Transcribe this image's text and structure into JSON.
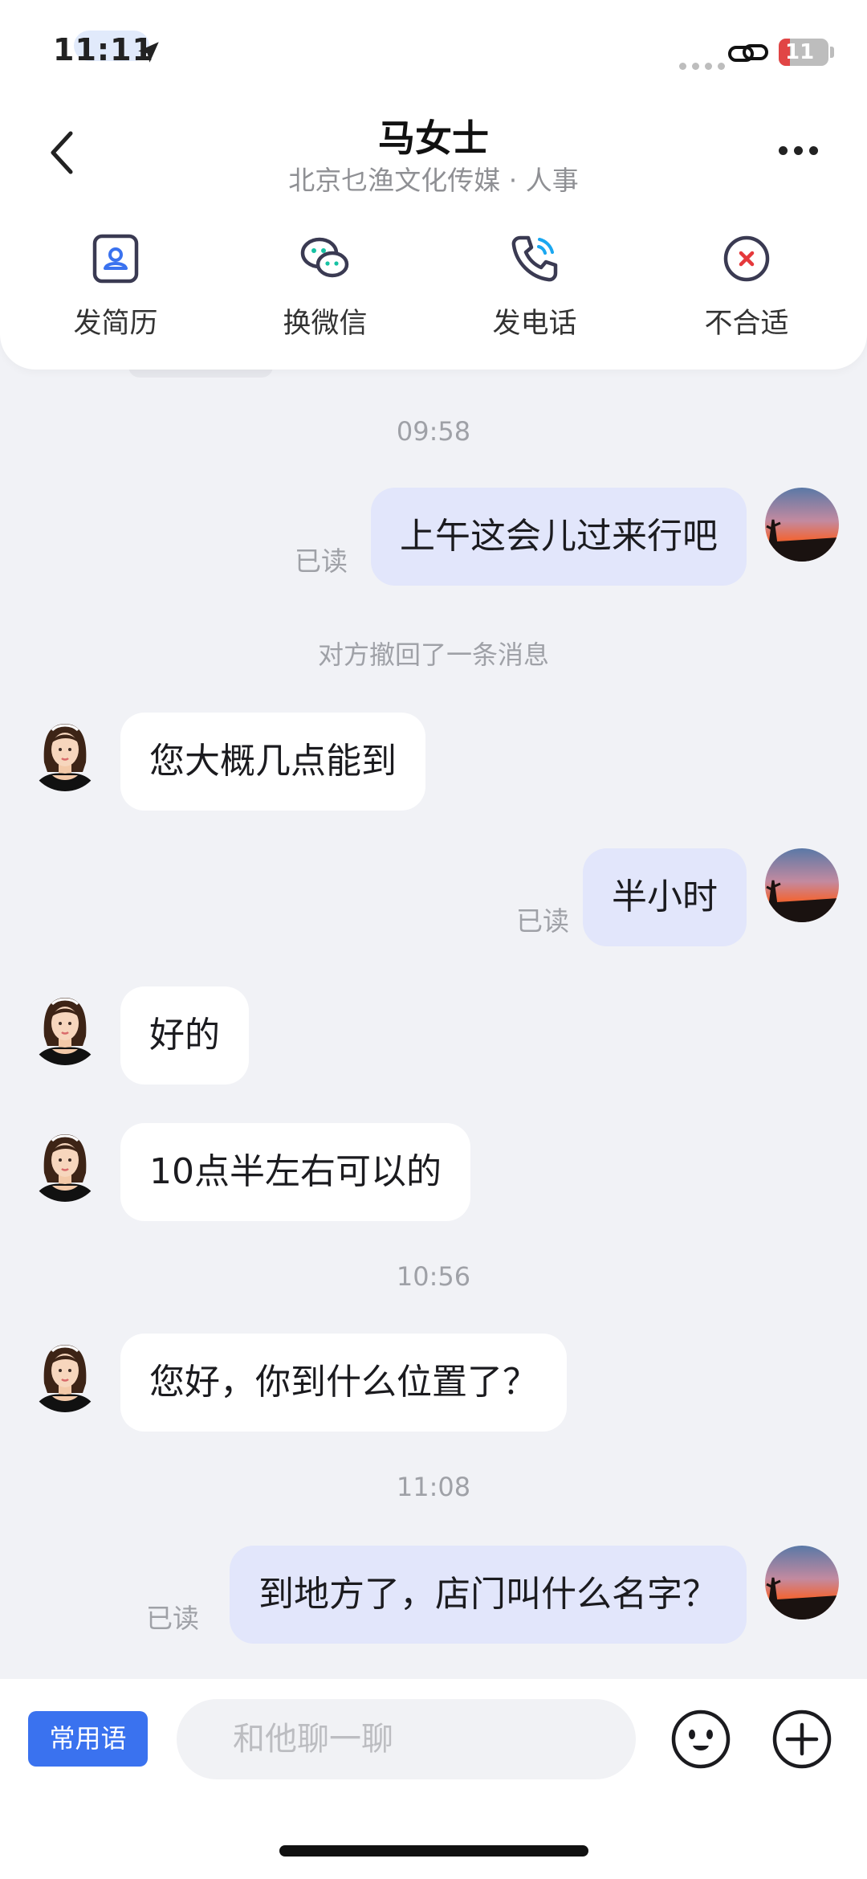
{
  "status_bar": {
    "time": "11:11",
    "battery": "11",
    "battery_level": 0.11,
    "icons": [
      "location-arrow-icon",
      "signal-dots-icon",
      "link-icon",
      "battery-icon"
    ]
  },
  "header": {
    "title": "马女士",
    "subtitle": "北京乜渔文化传媒 · 人事",
    "back_icon": "chevron-left-icon",
    "more_icon": "more-dots-icon"
  },
  "actions": [
    {
      "label": "发简历",
      "icon": "resume-icon"
    },
    {
      "label": "换微信",
      "icon": "wechat-icon"
    },
    {
      "label": "发电话",
      "icon": "phone-icon"
    },
    {
      "label": "不合适",
      "icon": "close-circle-icon"
    }
  ],
  "messages": [
    {
      "type": "time",
      "text": "09:58"
    },
    {
      "type": "message",
      "from": "me",
      "text": "上午这会儿过来行吧",
      "read_status": "已读"
    },
    {
      "type": "notice",
      "text": "对方撤回了一条消息"
    },
    {
      "type": "message",
      "from": "them",
      "text": "您大概几点能到"
    },
    {
      "type": "message",
      "from": "me",
      "text": "半小时",
      "read_status": "已读"
    },
    {
      "type": "message",
      "from": "them",
      "text": "好的"
    },
    {
      "type": "message",
      "from": "them",
      "text": "10点半左右可以的"
    },
    {
      "type": "time",
      "text": "10:56"
    },
    {
      "type": "message",
      "from": "them",
      "text": "您好，你到什么位置了？"
    },
    {
      "type": "time",
      "text": "11:08"
    },
    {
      "type": "message",
      "from": "me",
      "text": "到地方了，店门叫什么名字？",
      "read_status": "已读"
    }
  ],
  "input_bar": {
    "quick_phrase_label": "常用语",
    "placeholder": "和他聊一聊",
    "value": "",
    "emoji_icon": "smiley-icon",
    "plus_icon": "plus-circle-icon"
  },
  "colors": {
    "accent": "#3a72ef",
    "my_bubble": "#e2e6fb",
    "their_bubble": "#ffffff",
    "background": "#f1f2f6",
    "battery_low": "#e14545"
  }
}
